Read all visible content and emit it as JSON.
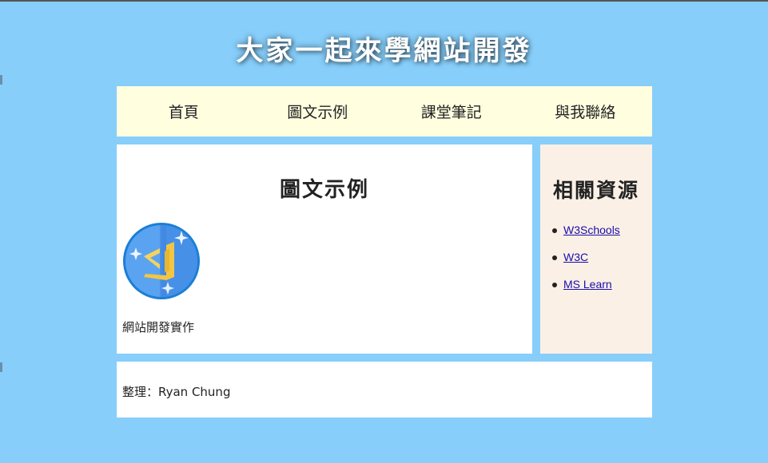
{
  "site": {
    "title": "大家一起來學網站開發",
    "background_color": "#87cefa"
  },
  "nav": {
    "items": [
      {
        "label": "首頁"
      },
      {
        "label": "圖文示例"
      },
      {
        "label": "課堂筆記"
      },
      {
        "label": "與我聯絡"
      }
    ],
    "background_color": "#ffffe0"
  },
  "main": {
    "title": "圖文示例",
    "image_icon": "vs-code-logo-icon",
    "caption": "網站開發實作"
  },
  "aside": {
    "title": "相關資源",
    "links": [
      {
        "label": "W3Schools"
      },
      {
        "label": "W3C"
      },
      {
        "label": "MS Learn"
      }
    ],
    "background_color": "#faf0e6"
  },
  "footer": {
    "text": "整理：Ryan Chung"
  }
}
